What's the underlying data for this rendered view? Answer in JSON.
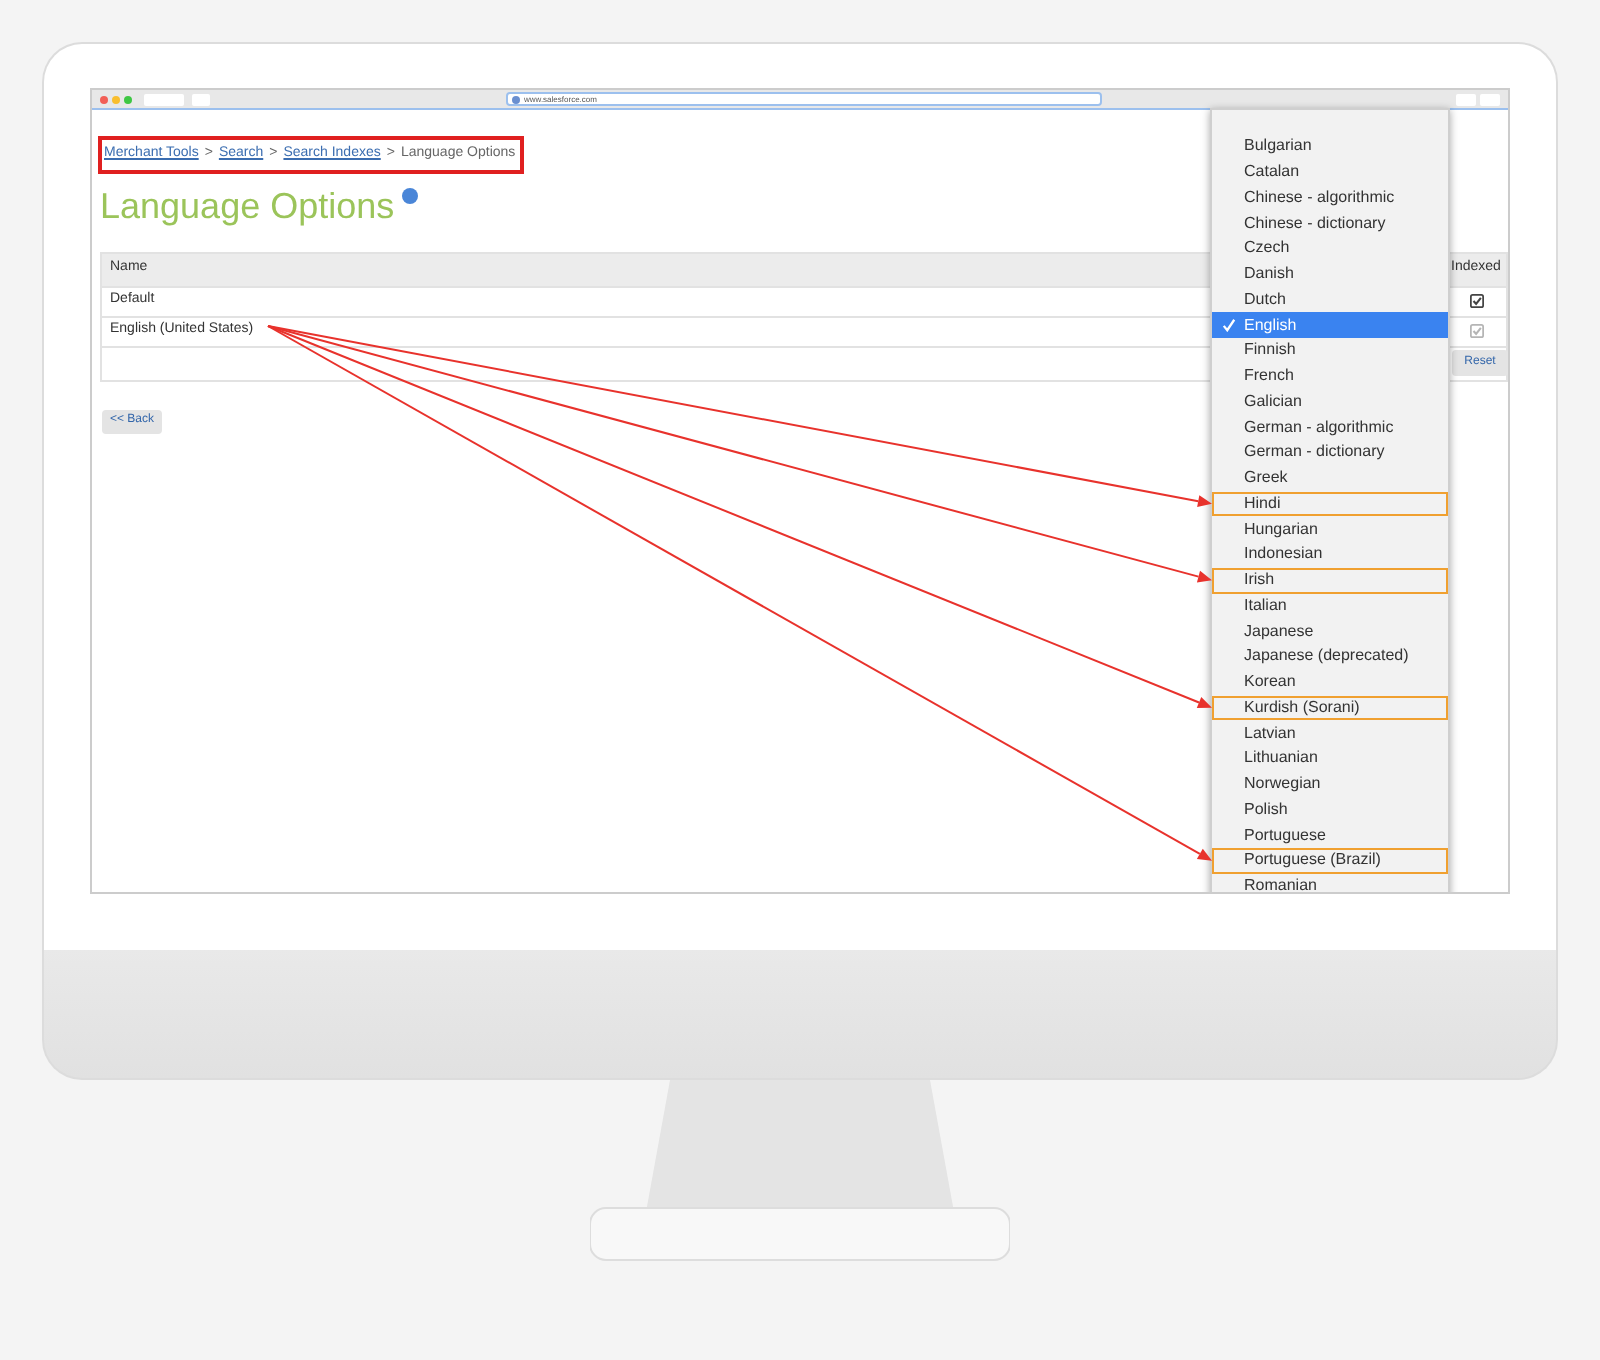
{
  "browser": {
    "url": "www.salesforce.com"
  },
  "breadcrumb": [
    {
      "label": "Merchant Tools",
      "link": true,
      "separator": ">"
    },
    {
      "label": "Search",
      "link": true,
      "separator": ">"
    },
    {
      "label": "Search Indexes",
      "link": true,
      "separator": ">"
    },
    {
      "label": "Language Options",
      "link": false
    }
  ],
  "page_title": "Language Options",
  "table": {
    "columns": [
      "Name",
      "Indexed"
    ],
    "rows": [
      {
        "name": "Default",
        "indexed": true,
        "disabled": false
      },
      {
        "name": "English (United States)",
        "indexed": true,
        "disabled": true
      }
    ]
  },
  "reset_button": "Reset",
  "back_button": "<< Back",
  "dropdown": {
    "items": [
      {
        "label": "Bulgarian",
        "selected": false,
        "highlighted": false
      },
      {
        "label": "Catalan",
        "selected": false,
        "highlighted": false
      },
      {
        "label": "Chinese - algorithmic",
        "selected": false,
        "highlighted": false
      },
      {
        "label": "Chinese - dictionary",
        "selected": false,
        "highlighted": false
      },
      {
        "label": "Czech",
        "selected": false,
        "highlighted": false
      },
      {
        "label": "Danish",
        "selected": false,
        "highlighted": false
      },
      {
        "label": "Dutch",
        "selected": false,
        "highlighted": false
      },
      {
        "label": "English",
        "selected": true,
        "highlighted": false
      },
      {
        "label": "Finnish",
        "selected": false,
        "highlighted": false
      },
      {
        "label": "French",
        "selected": false,
        "highlighted": false
      },
      {
        "label": "Galician",
        "selected": false,
        "highlighted": false
      },
      {
        "label": "German - algorithmic",
        "selected": false,
        "highlighted": false
      },
      {
        "label": "German - dictionary",
        "selected": false,
        "highlighted": false
      },
      {
        "label": "Greek",
        "selected": false,
        "highlighted": false
      },
      {
        "label": "Hindi",
        "selected": false,
        "highlighted": true
      },
      {
        "label": "Hungarian",
        "selected": false,
        "highlighted": false
      },
      {
        "label": "Indonesian",
        "selected": false,
        "highlighted": false
      },
      {
        "label": "Irish",
        "selected": false,
        "highlighted": true
      },
      {
        "label": "Italian",
        "selected": false,
        "highlighted": false
      },
      {
        "label": "Japanese",
        "selected": false,
        "highlighted": false
      },
      {
        "label": "Japanese (deprecated)",
        "selected": false,
        "highlighted": false
      },
      {
        "label": "Korean",
        "selected": false,
        "highlighted": false
      },
      {
        "label": "Kurdish (Sorani)",
        "selected": false,
        "highlighted": true
      },
      {
        "label": "Latvian",
        "selected": false,
        "highlighted": false
      },
      {
        "label": "Lithuanian",
        "selected": false,
        "highlighted": false
      },
      {
        "label": "Norwegian",
        "selected": false,
        "highlighted": false
      },
      {
        "label": "Polish",
        "selected": false,
        "highlighted": false
      },
      {
        "label": "Portuguese",
        "selected": false,
        "highlighted": false
      },
      {
        "label": "Portuguese (Brazil)",
        "selected": false,
        "highlighted": true
      },
      {
        "label": "Romanian",
        "selected": false,
        "highlighted": false
      }
    ]
  }
}
